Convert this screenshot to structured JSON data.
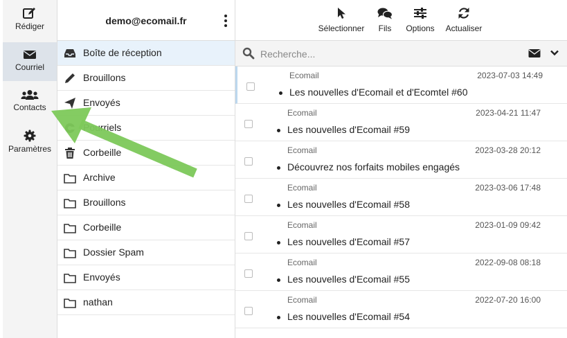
{
  "nav": {
    "items": [
      {
        "label": "Rédiger",
        "icon": "compose-icon"
      },
      {
        "label": "Courriel",
        "icon": "envelope-icon"
      },
      {
        "label": "Contacts",
        "icon": "users-icon"
      },
      {
        "label": "Paramètres",
        "icon": "gear-icon"
      }
    ]
  },
  "account": {
    "email": "demo@ecomail.fr"
  },
  "folders": [
    {
      "label": "Boîte de réception",
      "icon": "inbox-icon"
    },
    {
      "label": "Brouillons",
      "icon": "pencil-icon"
    },
    {
      "label": "Envoyés",
      "icon": "paper-plane-icon"
    },
    {
      "label": "Pourriels",
      "icon": "spam-icon"
    },
    {
      "label": "Corbeille",
      "icon": "trash-icon"
    },
    {
      "label": "Archive",
      "icon": "folder-icon"
    },
    {
      "label": "Brouillons",
      "icon": "folder-icon"
    },
    {
      "label": "Corbeille",
      "icon": "folder-icon"
    },
    {
      "label": "Dossier Spam",
      "icon": "folder-icon"
    },
    {
      "label": "Envoyés",
      "icon": "folder-icon"
    },
    {
      "label": "nathan",
      "icon": "folder-icon"
    }
  ],
  "toolbar": {
    "select_label": "Sélectionner",
    "threads_label": "Fils",
    "options_label": "Options",
    "refresh_label": "Actualiser"
  },
  "search": {
    "placeholder": "Recherche..."
  },
  "messages": [
    {
      "sender": "Ecomail",
      "date": "2023-07-03 14:49",
      "subject": "Les nouvelles d'Ecomail et d'Ecomtel #60"
    },
    {
      "sender": "Ecomail",
      "date": "2023-04-21 11:47",
      "subject": "Les nouvelles d'Ecomail #59"
    },
    {
      "sender": "Ecomail",
      "date": "2023-03-28 20:12",
      "subject": "Découvrez nos forfaits mobiles engagés"
    },
    {
      "sender": "Ecomail",
      "date": "2023-03-06 17:48",
      "subject": "Les nouvelles d'Ecomail #58"
    },
    {
      "sender": "Ecomail",
      "date": "2023-01-09 09:42",
      "subject": "Les nouvelles d'Ecomail #57"
    },
    {
      "sender": "Ecomail",
      "date": "2022-09-08 08:18",
      "subject": "Les nouvelles d'Ecomail #55"
    },
    {
      "sender": "Ecomail",
      "date": "2022-07-20 16:00",
      "subject": "Les nouvelles d'Ecomail #54"
    }
  ],
  "colors": {
    "accent": "#e8f2fb",
    "arrow": "#7dc95a",
    "nav_active": "#dde3ea"
  }
}
